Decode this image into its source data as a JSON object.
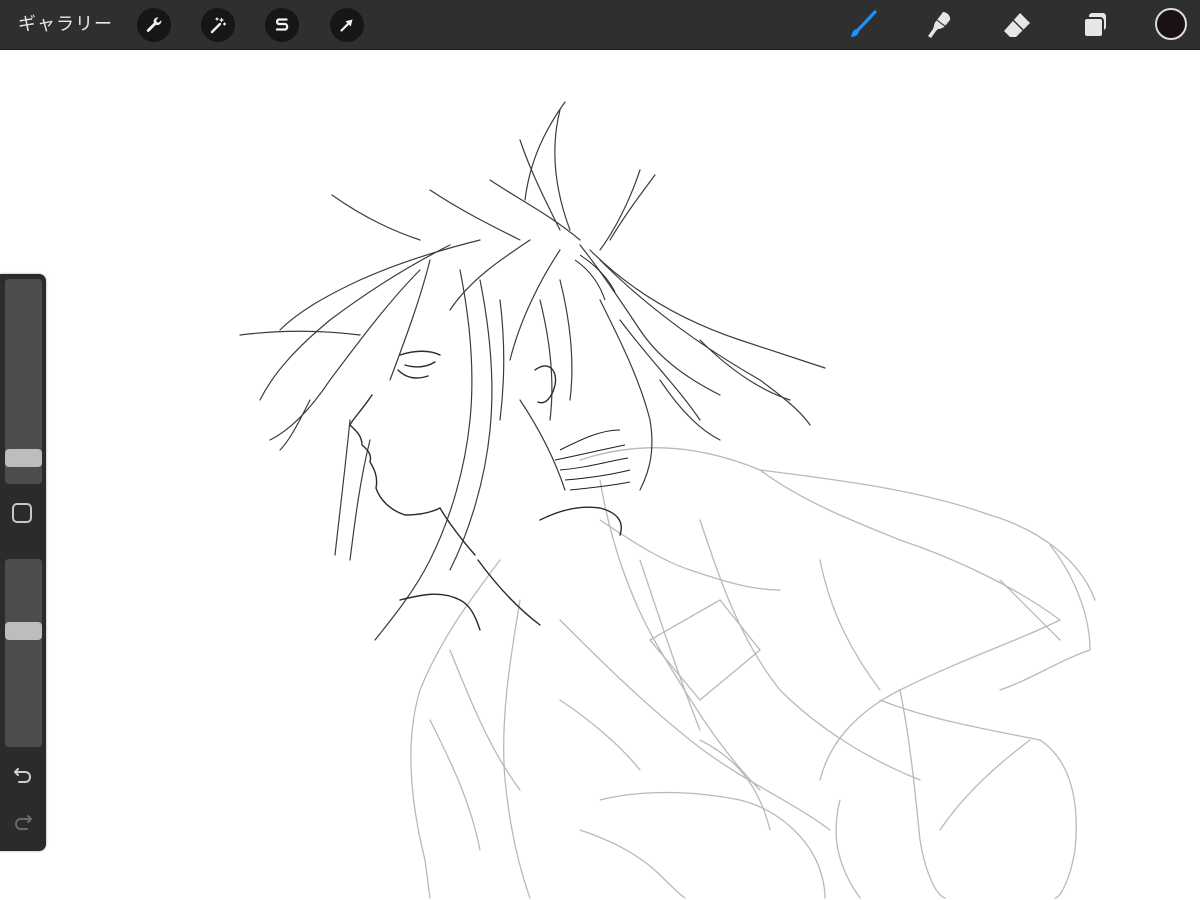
{
  "toolbar": {
    "gallery_label": "ギャラリー",
    "left_tools": [
      "wrench-icon",
      "magic-wand-icon",
      "selection-s-icon",
      "transform-arrow-icon"
    ],
    "right_tools": [
      "brush-icon",
      "smudge-icon",
      "eraser-icon",
      "layers-icon"
    ],
    "active_tool": "brush-icon",
    "accent_color": "#1f8fff",
    "current_color": "#1a1212"
  },
  "sidebar": {
    "brush_size": 0.09,
    "opacity": 0.63,
    "modify_icon": "square-icon",
    "undo_icon": "undo-icon",
    "redo_icon": "redo-icon"
  },
  "colors": {
    "toolbar_bg": "#2f2f2f",
    "sidebar_bg": "#2b2b2b",
    "canvas_bg": "#ffffff"
  }
}
